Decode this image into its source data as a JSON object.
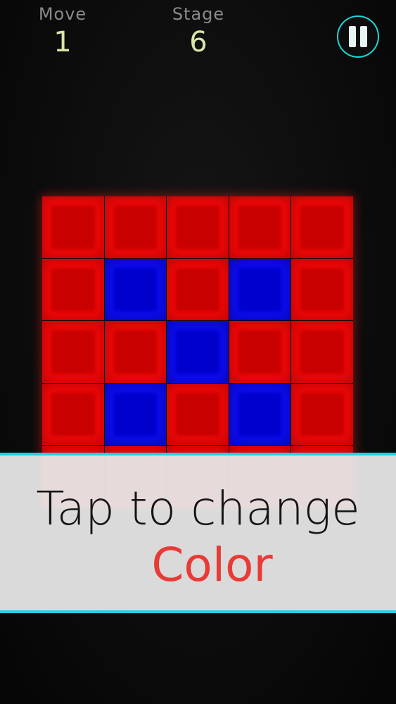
{
  "hud": {
    "move_label": "Move",
    "move_value": "1",
    "stage_label": "Stage",
    "stage_value": "6"
  },
  "pause": {
    "icon": "pause-icon"
  },
  "board": {
    "size": 5,
    "colors": {
      "red": "#ff0a0a",
      "blue": "#1010ff"
    },
    "cells": [
      [
        "red",
        "red",
        "red",
        "red",
        "red"
      ],
      [
        "red",
        "blue",
        "red",
        "blue",
        "red"
      ],
      [
        "red",
        "red",
        "blue",
        "red",
        "red"
      ],
      [
        "red",
        "blue",
        "red",
        "blue",
        "red"
      ],
      [
        "red",
        "red",
        "red",
        "red",
        "red"
      ]
    ]
  },
  "hint": {
    "line1": "Tap to change",
    "line2": "Color",
    "accent": "#e83a36",
    "border": "#1fd3df"
  }
}
